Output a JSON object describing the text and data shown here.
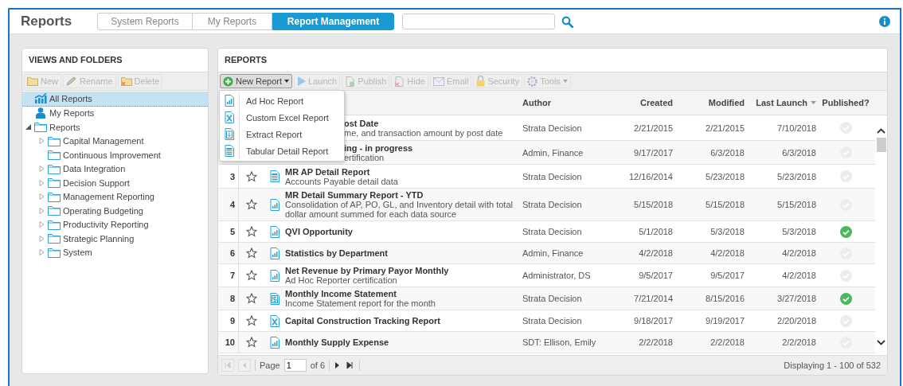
{
  "header": {
    "title": "Reports",
    "tabs": [
      {
        "label": "System Reports",
        "selected": false
      },
      {
        "label": "My Reports",
        "selected": false
      },
      {
        "label": "Report Management",
        "selected": true
      }
    ]
  },
  "folders_panel": {
    "title": "VIEWS AND FOLDERS",
    "toolbar": [
      {
        "label": "New",
        "kind": "new",
        "disabled": true
      },
      {
        "label": "Rename",
        "kind": "rename",
        "disabled": true
      },
      {
        "label": "Delete",
        "kind": "delete",
        "disabled": true
      }
    ],
    "tree": [
      {
        "label": "All Reports",
        "kind": "all",
        "selected": true
      },
      {
        "label": "My Reports",
        "kind": "user",
        "selected": false
      },
      {
        "label": "Reports",
        "kind": "folder",
        "selected": false,
        "expanded": true,
        "children": [
          {
            "label": "Capital Management",
            "kind": "folder",
            "selected": false,
            "expandable": true
          },
          {
            "label": "Continuous Improvement",
            "kind": "folder",
            "selected": false,
            "expandable": false
          },
          {
            "label": "Data Integration",
            "kind": "folder",
            "selected": false,
            "expandable": true
          },
          {
            "label": "Decision Support",
            "kind": "folder",
            "selected": false,
            "expandable": true
          },
          {
            "label": "Management Reporting",
            "kind": "folder",
            "selected": false,
            "expandable": true
          },
          {
            "label": "Operating Budgeting",
            "kind": "folder",
            "selected": false,
            "expandable": true
          },
          {
            "label": "Productivity Reporting",
            "kind": "folder",
            "selected": false,
            "expandable": true
          },
          {
            "label": "Strategic Planning",
            "kind": "folder",
            "selected": false,
            "expandable": true
          },
          {
            "label": "System",
            "kind": "folder",
            "selected": false,
            "expandable": true
          }
        ]
      }
    ]
  },
  "reports_panel": {
    "title": "REPORTS",
    "toolbar": [
      {
        "label": "New Report",
        "kind": "add",
        "disabled": false,
        "dropdown": true
      },
      {
        "label": "Launch",
        "kind": "launch",
        "disabled": true,
        "dropdown": false
      },
      {
        "label": "Publish",
        "kind": "publish",
        "disabled": true,
        "dropdown": false
      },
      {
        "label": "Hide",
        "kind": "hide",
        "disabled": true,
        "dropdown": false
      },
      {
        "label": "Email",
        "kind": "email",
        "disabled": true,
        "dropdown": false
      },
      {
        "label": "Security",
        "kind": "security",
        "disabled": true,
        "dropdown": false
      },
      {
        "label": "Tools",
        "kind": "tools",
        "disabled": true,
        "dropdown": true
      }
    ],
    "menu": [
      {
        "label": "Ad Hoc Report",
        "kind": "chart"
      },
      {
        "label": "Custom Excel Report",
        "kind": "excel"
      },
      {
        "label": "Extract Report",
        "kind": "extract"
      },
      {
        "label": "Tabular Detail Report",
        "kind": "table"
      }
    ],
    "columns": [
      {
        "label": "Author",
        "sorted": false
      },
      {
        "label": "Created",
        "sorted": false
      },
      {
        "label": "Modified",
        "sorted": false
      },
      {
        "label": "Last Launch",
        "sorted": true
      },
      {
        "label": "Published?",
        "sorted": false
      }
    ],
    "rows": [
      {
        "name": "ost Date",
        "description": "me, and transaction amount by post date",
        "author": "Strata Decision",
        "created": "2/21/2015",
        "modified": "2/21/2015",
        "last_launch": "7/10/2018",
        "published": false
      },
      {
        "name": "ing - in progress",
        "description": "ertification",
        "author": "Admin, Finance",
        "created": "9/17/2017",
        "modified": "6/3/2018",
        "last_launch": "6/3/2018",
        "published": false
      },
      {
        "number": "3",
        "kind": "table",
        "name": "MR AP Detail Report",
        "description": "Accounts Payable detail data",
        "author": "Strata Decision",
        "created": "12/16/2014",
        "modified": "5/23/2018",
        "last_launch": "5/23/2018",
        "published": false
      },
      {
        "number": "4",
        "kind": "chart",
        "name": "MR Detail Summary Report - YTD",
        "description": "Consolidation of AP, PO, GL, and Inventory detail with total dollar amount summed for each data source",
        "author": "Strata Decision",
        "created": "5/15/2018",
        "modified": "5/15/2018",
        "last_launch": "5/15/2018",
        "published": false
      },
      {
        "number": "5",
        "kind": "chart",
        "name": "QVI Opportunity",
        "author": "Strata Decision",
        "created": "5/1/2018",
        "modified": "5/3/2018",
        "last_launch": "5/3/2018",
        "published": true
      },
      {
        "number": "6",
        "kind": "chart",
        "name": "Statistics by Department",
        "author": "Admin, Finance",
        "created": "4/2/2018",
        "modified": "4/2/2018",
        "last_launch": "4/2/2018",
        "published": false
      },
      {
        "number": "7",
        "kind": "chart",
        "name": "Net Revenue by Primary Payor Monthly",
        "description": "Ad Hoc Reporter certification",
        "author": "Administrator, DS",
        "created": "9/5/2017",
        "modified": "9/5/2017",
        "last_launch": "4/2/2018",
        "published": false
      },
      {
        "number": "8",
        "kind": "dollar",
        "name": "Monthly Income Statement",
        "description": "Income Statement report for the month",
        "author": "Strata Decision",
        "created": "7/21/2014",
        "modified": "8/15/2016",
        "last_launch": "3/27/2018",
        "published": true
      },
      {
        "number": "9",
        "kind": "excel",
        "name": "Capital Construction Tracking Report",
        "author": "Strata Decision",
        "created": "9/18/2017",
        "modified": "9/19/2017",
        "last_launch": "2/20/2018",
        "published": false
      },
      {
        "number": "10",
        "kind": "chart",
        "name": "Monthly Supply Expense",
        "author": "SDT: Ellison, Emily",
        "created": "2/2/2018",
        "modified": "2/2/2018",
        "last_launch": "2/2/2018",
        "published": false
      }
    ],
    "pager": {
      "page_label": "Page",
      "page": "1",
      "of": "of 6",
      "status": "Displaying 1 - 100 of 532"
    }
  }
}
